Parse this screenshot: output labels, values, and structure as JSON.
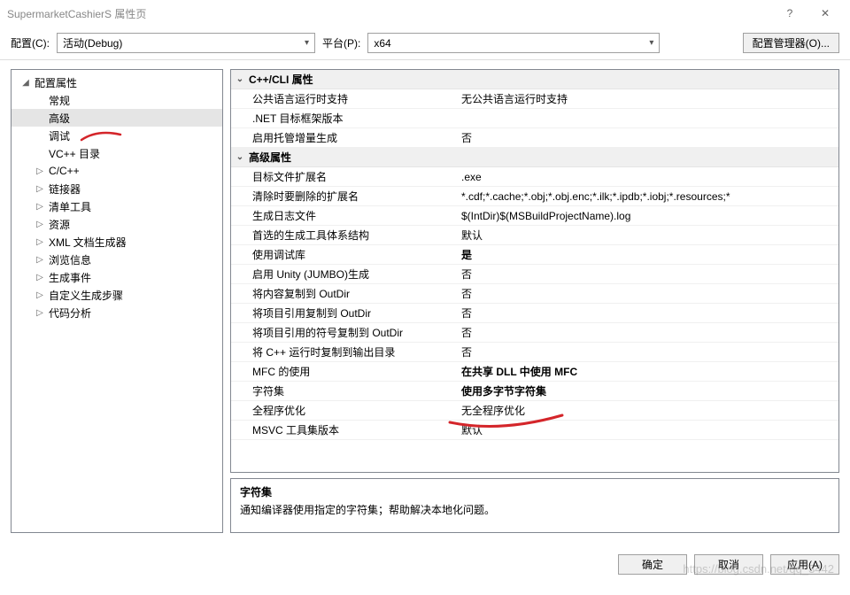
{
  "window": {
    "title": "SupermarketCashierS 属性页",
    "help": "?",
    "close": "✕"
  },
  "toolbar": {
    "config_label": "配置(C):",
    "config_value": "活动(Debug)",
    "platform_label": "平台(P):",
    "platform_value": "x64",
    "manager_btn": "配置管理器(O)..."
  },
  "tree": {
    "root": "配置属性",
    "items": [
      {
        "label": "常规"
      },
      {
        "label": "高级",
        "sel": true
      },
      {
        "label": "调试"
      },
      {
        "label": "VC++ 目录"
      },
      {
        "label": "C/C++",
        "expandable": true
      },
      {
        "label": "链接器",
        "expandable": true
      },
      {
        "label": "清单工具",
        "expandable": true
      },
      {
        "label": "资源",
        "expandable": true
      },
      {
        "label": "XML 文档生成器",
        "expandable": true
      },
      {
        "label": "浏览信息",
        "expandable": true
      },
      {
        "label": "生成事件",
        "expandable": true
      },
      {
        "label": "自定义生成步骤",
        "expandable": true
      },
      {
        "label": "代码分析",
        "expandable": true
      }
    ]
  },
  "grid": {
    "sections": [
      {
        "title": "C++/CLI 属性",
        "rows": [
          {
            "prop": "公共语言运行时支持",
            "val": "无公共语言运行时支持"
          },
          {
            "prop": ".NET 目标框架版本",
            "val": ""
          },
          {
            "prop": "启用托管增量生成",
            "val": "否"
          }
        ]
      },
      {
        "title": "高级属性",
        "rows": [
          {
            "prop": "目标文件扩展名",
            "val": ".exe"
          },
          {
            "prop": "清除时要删除的扩展名",
            "val": "*.cdf;*.cache;*.obj;*.obj.enc;*.ilk;*.ipdb;*.iobj;*.resources;*"
          },
          {
            "prop": "生成日志文件",
            "val": "$(IntDir)$(MSBuildProjectName).log"
          },
          {
            "prop": "首选的生成工具体系结构",
            "val": "默认"
          },
          {
            "prop": "使用调试库",
            "val": "是",
            "bold": true
          },
          {
            "prop": "启用 Unity (JUMBO)生成",
            "val": "否"
          },
          {
            "prop": "将内容复制到 OutDir",
            "val": "否"
          },
          {
            "prop": "将项目引用复制到 OutDir",
            "val": "否"
          },
          {
            "prop": "将项目引用的符号复制到 OutDir",
            "val": "否"
          },
          {
            "prop": "将 C++ 运行时复制到输出目录",
            "val": "否"
          },
          {
            "prop": "MFC 的使用",
            "val": "在共享 DLL 中使用 MFC",
            "bold": true
          },
          {
            "prop": "字符集",
            "val": "使用多字节字符集",
            "bold": true
          },
          {
            "prop": "全程序优化",
            "val": "无全程序优化"
          },
          {
            "prop": "MSVC 工具集版本",
            "val": "默认"
          }
        ]
      }
    ]
  },
  "desc": {
    "title": "字符集",
    "text": "通知编译器使用指定的字符集；帮助解决本地化问题。"
  },
  "footer": {
    "ok": "确定",
    "cancel": "取消",
    "apply": "应用(A)"
  },
  "watermark": "https://blog.csdn.net/qq_3442"
}
